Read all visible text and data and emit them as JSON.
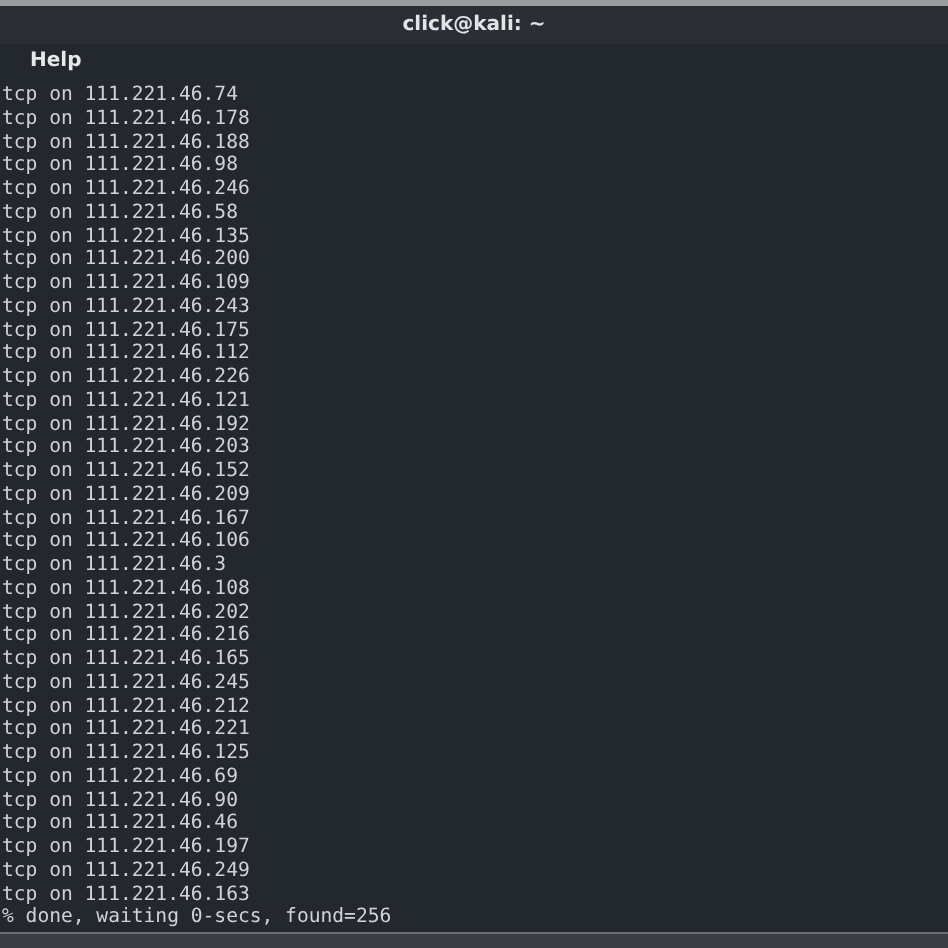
{
  "window": {
    "title": "click@kali: ~"
  },
  "menu": [
    "Help"
  ],
  "terminal": {
    "lines": [
      "tcp on 111.221.46.74",
      "tcp on 111.221.46.178",
      "tcp on 111.221.46.188",
      "tcp on 111.221.46.98",
      "tcp on 111.221.46.246",
      "tcp on 111.221.46.58",
      "tcp on 111.221.46.135",
      "tcp on 111.221.46.200",
      "tcp on 111.221.46.109",
      "tcp on 111.221.46.243",
      "tcp on 111.221.46.175",
      "tcp on 111.221.46.112",
      "tcp on 111.221.46.226",
      "tcp on 111.221.46.121",
      "tcp on 111.221.46.192",
      "tcp on 111.221.46.203",
      "tcp on 111.221.46.152",
      "tcp on 111.221.46.209",
      "tcp on 111.221.46.167",
      "tcp on 111.221.46.106",
      "tcp on 111.221.46.3",
      "tcp on 111.221.46.108",
      "tcp on 111.221.46.202",
      "tcp on 111.221.46.216",
      "tcp on 111.221.46.165",
      "tcp on 111.221.46.245",
      "tcp on 111.221.46.212",
      "tcp on 111.221.46.221",
      "tcp on 111.221.46.125",
      "tcp on 111.221.46.69",
      "tcp on 111.221.46.90",
      "tcp on 111.221.46.46",
      "tcp on 111.221.46.197",
      "tcp on 111.221.46.249",
      "tcp on 111.221.46.163",
      "% done, waiting 0-secs, found=256"
    ]
  }
}
